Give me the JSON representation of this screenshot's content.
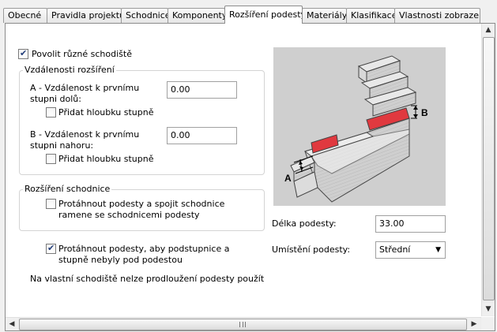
{
  "tabs": [
    "Obecné",
    "Pravidla projektu",
    "Schodnice",
    "Komponenty",
    "Rozšíření podesty",
    "Materiály",
    "Klasifikace",
    "Vlastnosti zobrazení"
  ],
  "allow_different": {
    "label": "Povolit různé schodiště",
    "checked": true
  },
  "distances": {
    "title": "Vzdálenosti rozšíření",
    "a_label": "A - Vzdálenost k prvnímu stupni dolů:",
    "a_value": "0.00",
    "a_add_depth": "Přidat hloubku stupně",
    "b_label": "B - Vzdálenost k prvnímu stupni nahoru:",
    "b_value": "0.00",
    "b_add_depth": "Přidat hloubku stupně"
  },
  "stringer_ext": {
    "title": "Rozšíření schodnice",
    "extend_join": "Protáhnout podesty a spojit schodnice ramene se schodnicemi podesty"
  },
  "extend_risers": {
    "label": "Protáhnout podesty, aby podstupnice a stupně nebyly pod podestou",
    "checked": true
  },
  "note": "Na vlastní schodiště nelze prodloužení podesty použít",
  "diagram": {
    "label_a": "A",
    "label_b": "B"
  },
  "landing_length": {
    "label": "Délka podesty:",
    "value": "33.00"
  },
  "landing_position": {
    "label": "Umístění podesty:",
    "value": "Střední"
  },
  "colors": {
    "accent_red": "#e0393f",
    "panel_border": "#8c8c8c"
  }
}
